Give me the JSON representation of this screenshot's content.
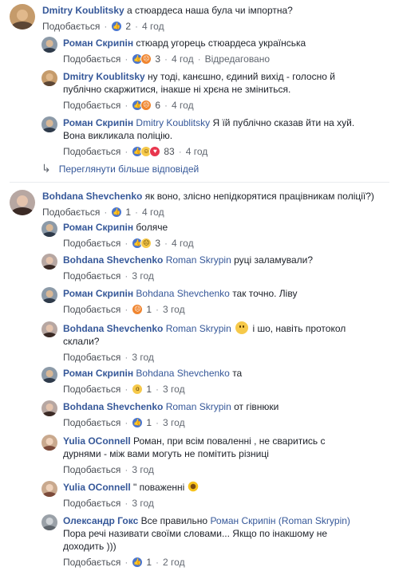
{
  "ui": {
    "like": "Подобається",
    "sep": "·",
    "more_replies": "Переглянути більше відповідей"
  },
  "comments": [
    {
      "id": "c1",
      "author": "Dmitry Koublitsky",
      "text": "а стюардеса наша була чи імпортна?",
      "reaction_count": "2",
      "time": "4 год",
      "reactions": [
        "like-icon"
      ],
      "avatar": {
        "bg": "#c59b6b",
        "face": "#e1b98c",
        "body": "#5c4634"
      }
    },
    {
      "id": "r1",
      "author": "Роман Скрипін",
      "text": "стюард угорець стюардеса українська",
      "reaction_count": "3",
      "time": "4 год",
      "edited": "Відредаговано",
      "reactions": [
        "like-icon",
        "angry-icon"
      ],
      "avatar": {
        "bg": "#8c9aa8",
        "face": "#d8b897",
        "body": "#2e3a4a"
      }
    },
    {
      "id": "r2",
      "author": "Dmitry Koublitsky",
      "text_line1": "ну тоді, канєшно, єдиний вихід - голосно й",
      "text_line2": "публічно скаржитися, інакше ні хрєна не зміниться.",
      "reaction_count": "6",
      "time": "4 год",
      "reactions": [
        "like-icon",
        "angry-icon"
      ]
    },
    {
      "id": "r3",
      "author": "Роман Скрипін",
      "mention": "Dmitry Koublitsky",
      "text_line1": "Я їй публічно сказав йти на хуй.",
      "text_line2": "Вона викликала поліцію.",
      "reaction_count": "83",
      "time": "4 год",
      "reactions": [
        "like-icon",
        "haha-icon",
        "love-icon"
      ]
    },
    {
      "id": "c2",
      "author": "Bohdana Shevchenko",
      "text": "як воно, злісно непідкорятися працівникам поліції?)",
      "reaction_count": "1",
      "time": "4 год",
      "reactions": [
        "like-icon"
      ],
      "avatar": {
        "bg": "#b7a7a2",
        "face": "#e4c3ad",
        "body": "#3b2a25"
      }
    },
    {
      "id": "r4",
      "author": "Роман Скрипін",
      "text": "боляче",
      "reaction_count": "3",
      "time": "4 год",
      "reactions": [
        "like-icon",
        "sad-icon"
      ]
    },
    {
      "id": "r5",
      "author": "Bohdana Shevchenko",
      "mention": "Roman Skrypin",
      "text": "руці заламували?",
      "time": "3 год"
    },
    {
      "id": "r6",
      "author": "Роман Скрипін",
      "mention": "Bohdana Shevchenko",
      "text": "так точно. Ліву",
      "reaction_count": "1",
      "time": "3 год",
      "reactions": [
        "angry-icon"
      ]
    },
    {
      "id": "r7",
      "author": "Bohdana Shevchenko",
      "mention": "Roman Skrypin",
      "text_line1": "і шо, навіть протокол",
      "text_line2": "склали?",
      "time": "3 год"
    },
    {
      "id": "r8",
      "author": "Роман Скрипін",
      "mention": "Bohdana Shevchenko",
      "text": "та",
      "reaction_count": "1",
      "time": "3 год",
      "reactions": [
        "wow-icon"
      ]
    },
    {
      "id": "r9",
      "author": "Bohdana Shevchenko",
      "mention": "Roman Skrypin",
      "text": "от гівнюки",
      "reaction_count": "1",
      "time": "3 год",
      "reactions": [
        "like-icon"
      ]
    },
    {
      "id": "r10",
      "author": "Yulia OConnell",
      "text_line1": "Роман, при всім поваленні , не сваритись с",
      "text_line2": "дурнями - між вами могуть не помітить різниці",
      "time": "3 год",
      "avatar": {
        "bg": "#c9a98e",
        "face": "#efd2bb",
        "body": "#7b4a3a"
      }
    },
    {
      "id": "r11",
      "author": "Yulia OConnell",
      "text": "\" поваженні",
      "time": "3 год"
    },
    {
      "id": "r12",
      "author": "Олександр Гокс",
      "text_pre": "Все правильно",
      "mention": "Роман Скрипін (Roman Skrypin)",
      "text_line2": "Пора речі називати своїми словами... Якщо по інакшому не",
      "text_line3": "доходить )))",
      "reaction_count": "1",
      "time": "2 год",
      "reactions": [
        "like-icon"
      ],
      "avatar": {
        "bg": "#9aa1a8",
        "face": "#cfd3d7",
        "body": "#5f666d"
      }
    }
  ]
}
